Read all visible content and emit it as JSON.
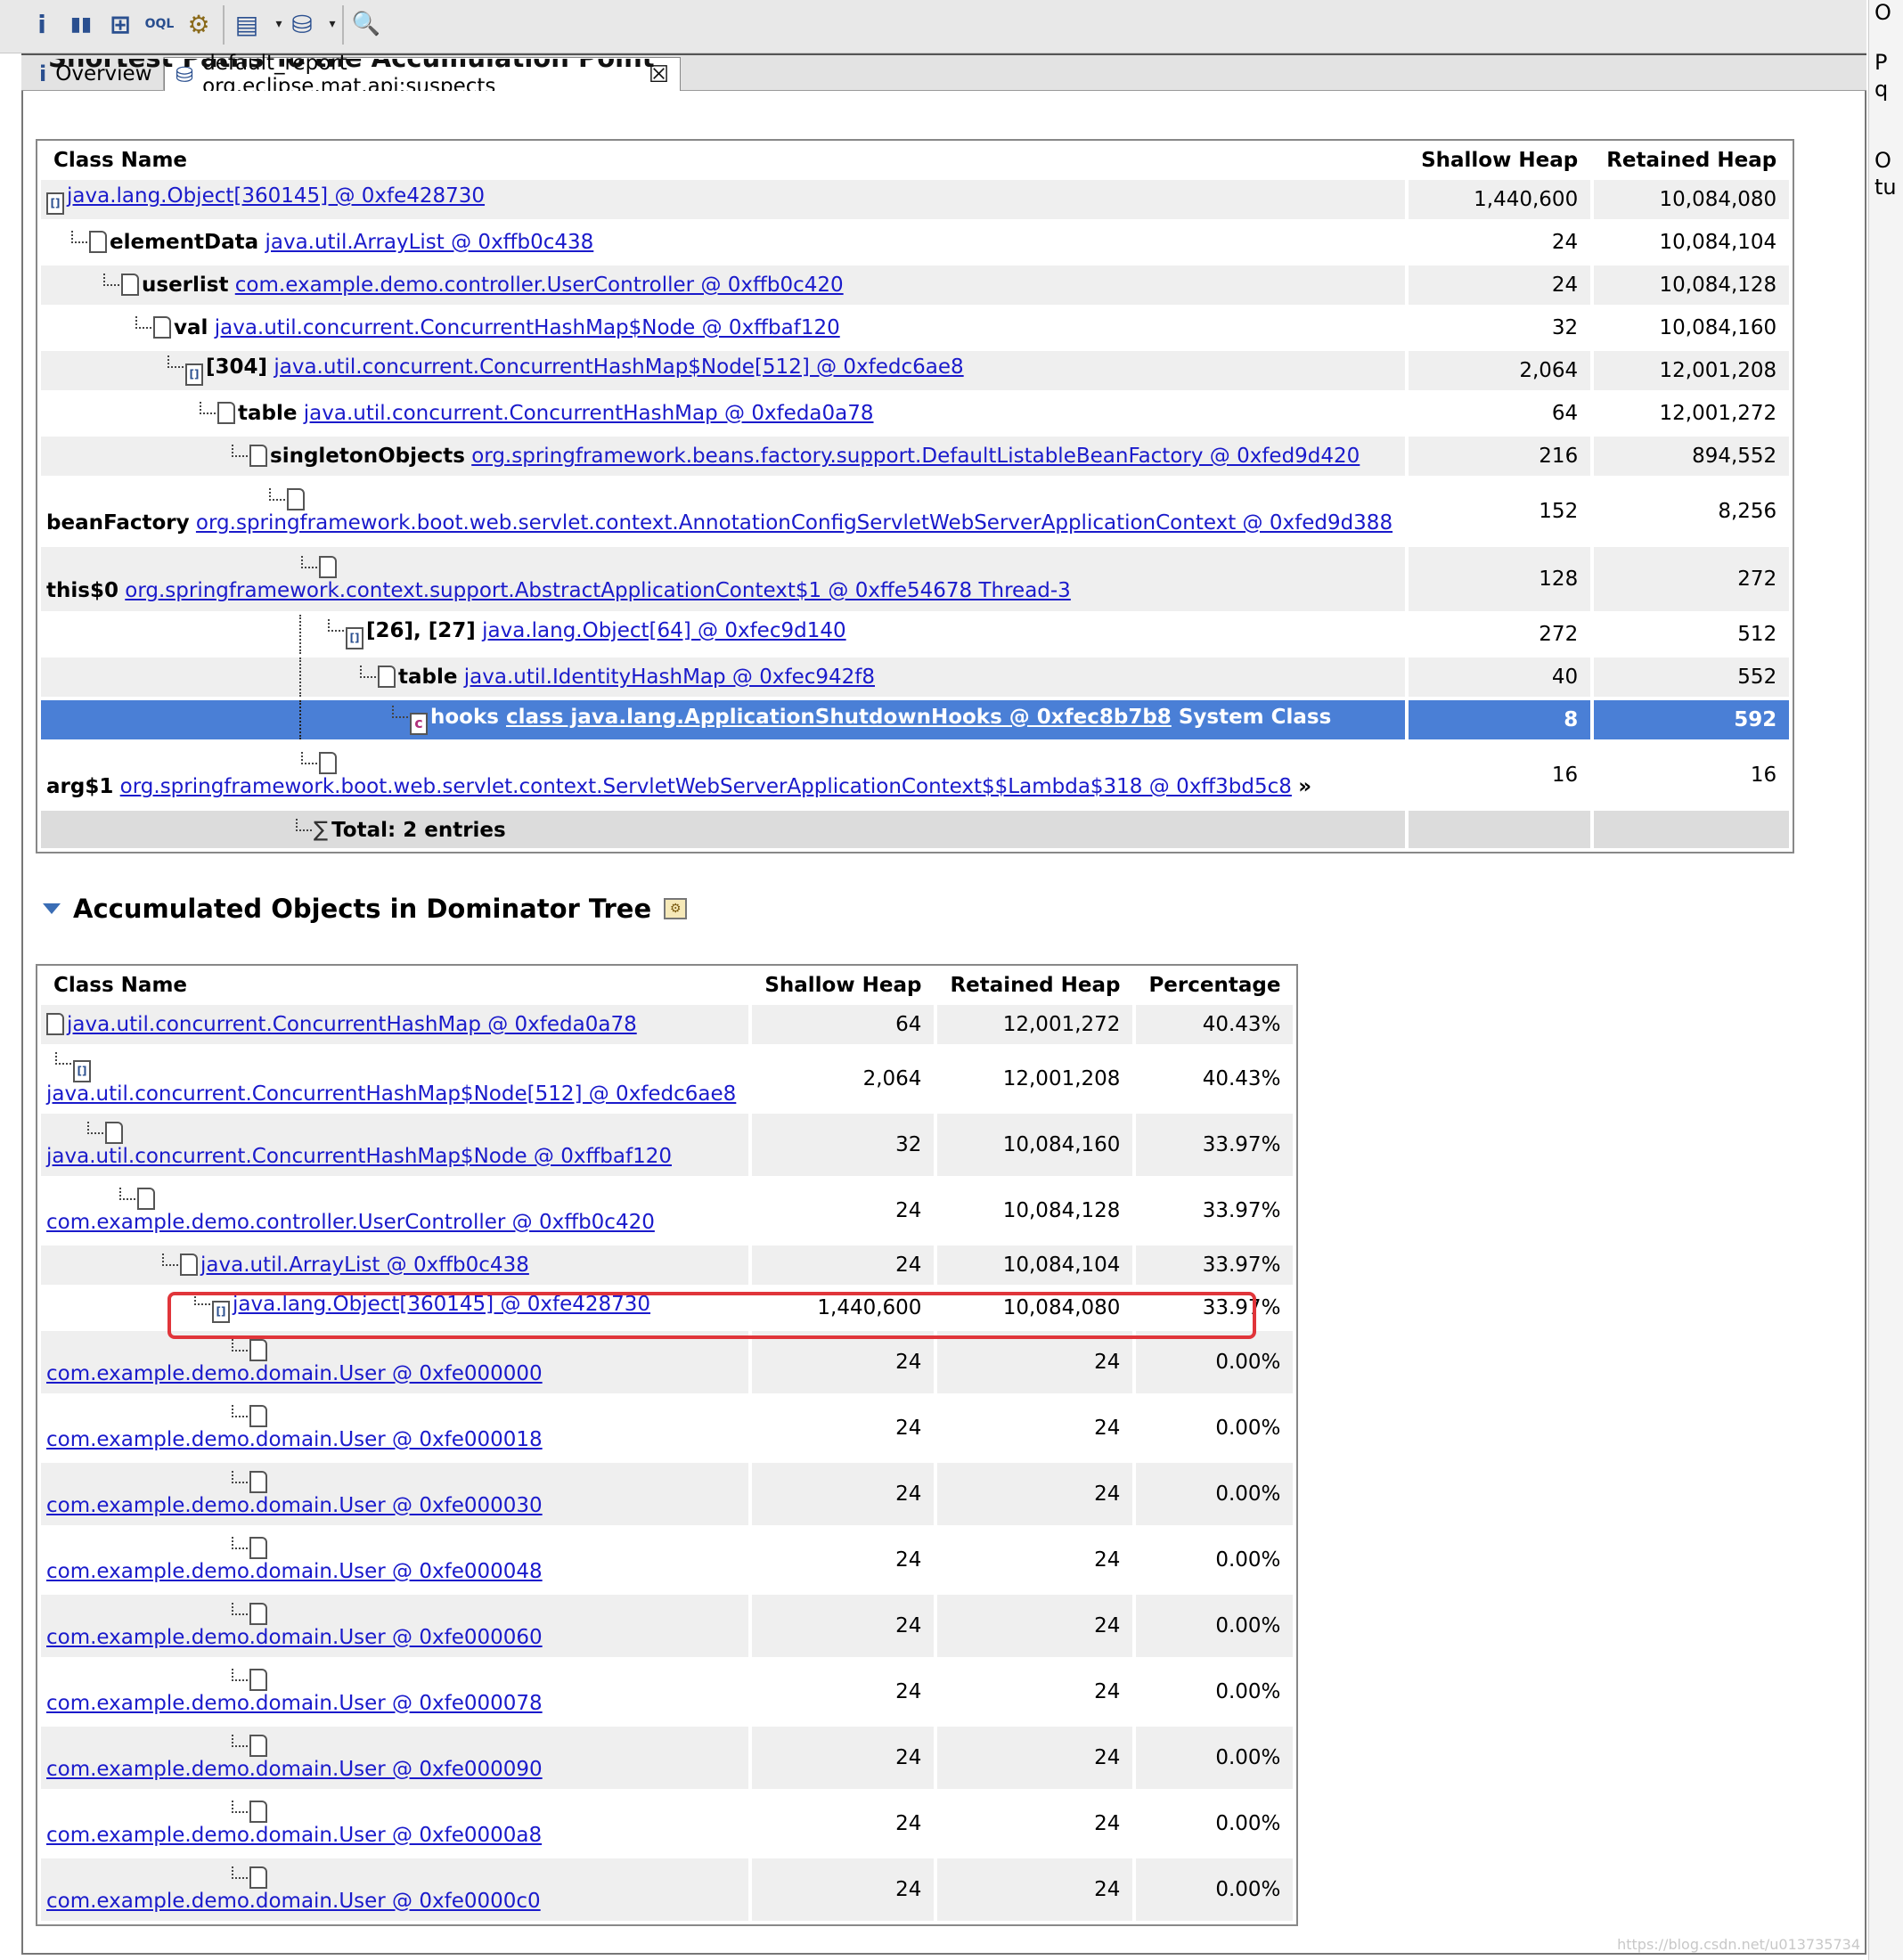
{
  "toolbar": {
    "icons": [
      "info-icon",
      "histogram-icon",
      "dominator-tree-icon",
      "oql-icon",
      "heap-dump-overview-icon",
      "query-browser-icon",
      "find-leaks-icon",
      "search-icon"
    ],
    "glyphs": [
      "i",
      "▮▮",
      "⊞",
      "OQL",
      "⚙",
      "▤",
      "⛁",
      "🔍"
    ]
  },
  "tabs": [
    {
      "label": "Overview",
      "icon": "i"
    },
    {
      "label": "default_report  org.eclipse.mat.api:suspects",
      "icon": "⛁",
      "close": "☒"
    }
  ],
  "cut_heading": "Shortest Paths To the Accumulation Point",
  "paths_table": {
    "columns": [
      "Class Name",
      "Shallow Heap",
      "Retained Heap"
    ],
    "rows": [
      {
        "field": "",
        "link": "java.lang.Object[360145] @ 0xfe428730",
        "suffix": "",
        "shallow": "1,440,600",
        "retained": "10,084,080"
      },
      {
        "field": "elementData",
        "link": "java.util.ArrayList @ 0xffb0c438",
        "suffix": "",
        "shallow": "24",
        "retained": "10,084,104"
      },
      {
        "field": "userlist",
        "link": "com.example.demo.controller.UserController @ 0xffb0c420",
        "suffix": "",
        "shallow": "24",
        "retained": "10,084,128"
      },
      {
        "field": "val",
        "link": "java.util.concurrent.ConcurrentHashMap$Node @ 0xffbaf120",
        "suffix": "",
        "shallow": "32",
        "retained": "10,084,160"
      },
      {
        "field": "[304]",
        "link": "java.util.concurrent.ConcurrentHashMap$Node[512] @ 0xfedc6ae8",
        "suffix": "",
        "shallow": "2,064",
        "retained": "12,001,208"
      },
      {
        "field": "table",
        "link": "java.util.concurrent.ConcurrentHashMap @ 0xfeda0a78",
        "suffix": "",
        "shallow": "64",
        "retained": "12,001,272"
      },
      {
        "field": "singletonObjects",
        "link": "org.springframework.beans.factory.support.DefaultListableBeanFactory @ 0xfed9d420",
        "suffix": "",
        "shallow": "216",
        "retained": "894,552"
      },
      {
        "field": "beanFactory",
        "link": "org.springframework.boot.web.servlet.context.AnnotationConfigServletWebServerApplicationContext @ 0xfed9d388",
        "suffix": "",
        "shallow": "152",
        "retained": "8,256"
      },
      {
        "field": "this$0",
        "link": "org.springframework.context.support.AbstractApplicationContext$1 @ 0xffe54678 Thread-3",
        "suffix": "",
        "shallow": "128",
        "retained": "272"
      },
      {
        "field": "[26], [27]",
        "link": "java.lang.Object[64] @ 0xfec9d140",
        "suffix": "",
        "shallow": "272",
        "retained": "512"
      },
      {
        "field": "table",
        "link": "java.util.IdentityHashMap @ 0xfec942f8",
        "suffix": "",
        "shallow": "40",
        "retained": "552"
      },
      {
        "field": "hooks",
        "link": "class java.lang.ApplicationShutdownHooks @ 0xfec8b7b8",
        "suffix": "System Class",
        "shallow": "8",
        "retained": "592"
      },
      {
        "field": "arg$1",
        "link": "org.springframework.boot.web.servlet.context.ServletWebServerApplicationContext$$Lambda$318 @ 0xff3bd5c8",
        "suffix": "»",
        "shallow": "16",
        "retained": "16"
      }
    ],
    "total": "Total: 2 entries"
  },
  "dominator_section": {
    "title": "Accumulated Objects in Dominator Tree"
  },
  "dominator_table": {
    "columns": [
      "Class Name",
      "Shallow Heap",
      "Retained Heap",
      "Percentage"
    ],
    "rows": [
      {
        "link": "java.util.concurrent.ConcurrentHashMap @ 0xfeda0a78",
        "shallow": "64",
        "retained": "12,001,272",
        "pct": "40.43%"
      },
      {
        "link": "java.util.concurrent.ConcurrentHashMap$Node[512] @ 0xfedc6ae8",
        "shallow": "2,064",
        "retained": "12,001,208",
        "pct": "40.43%"
      },
      {
        "link": "java.util.concurrent.ConcurrentHashMap$Node @ 0xffbaf120",
        "shallow": "32",
        "retained": "10,084,160",
        "pct": "33.97%"
      },
      {
        "link": "com.example.demo.controller.UserController @ 0xffb0c420",
        "shallow": "24",
        "retained": "10,084,128",
        "pct": "33.97%"
      },
      {
        "link": "java.util.ArrayList @ 0xffb0c438",
        "shallow": "24",
        "retained": "10,084,104",
        "pct": "33.97%"
      },
      {
        "link": "java.lang.Object[360145] @ 0xfe428730",
        "shallow": "1,440,600",
        "retained": "10,084,080",
        "pct": "33.97%"
      },
      {
        "link": "com.example.demo.domain.User @ 0xfe000000",
        "shallow": "24",
        "retained": "24",
        "pct": "0.00%"
      },
      {
        "link": "com.example.demo.domain.User @ 0xfe000018",
        "shallow": "24",
        "retained": "24",
        "pct": "0.00%"
      },
      {
        "link": "com.example.demo.domain.User @ 0xfe000030",
        "shallow": "24",
        "retained": "24",
        "pct": "0.00%"
      },
      {
        "link": "com.example.demo.domain.User @ 0xfe000048",
        "shallow": "24",
        "retained": "24",
        "pct": "0.00%"
      },
      {
        "link": "com.example.demo.domain.User @ 0xfe000060",
        "shallow": "24",
        "retained": "24",
        "pct": "0.00%"
      },
      {
        "link": "com.example.demo.domain.User @ 0xfe000078",
        "shallow": "24",
        "retained": "24",
        "pct": "0.00%"
      },
      {
        "link": "com.example.demo.domain.User @ 0xfe000090",
        "shallow": "24",
        "retained": "24",
        "pct": "0.00%"
      },
      {
        "link": "com.example.demo.domain.User @ 0xfe0000a8",
        "shallow": "24",
        "retained": "24",
        "pct": "0.00%"
      },
      {
        "link": "com.example.demo.domain.User @ 0xfe0000c0",
        "shallow": "24",
        "retained": "24",
        "pct": "0.00%"
      }
    ]
  },
  "right_strip": [
    "O",
    "P",
    "q",
    "O",
    "tu"
  ],
  "watermark": "https://blog.csdn.net/u013735734",
  "colors": {
    "selection": "#4a7fd6",
    "link": "#1a1acb",
    "highlight_box": "#e0353a"
  }
}
